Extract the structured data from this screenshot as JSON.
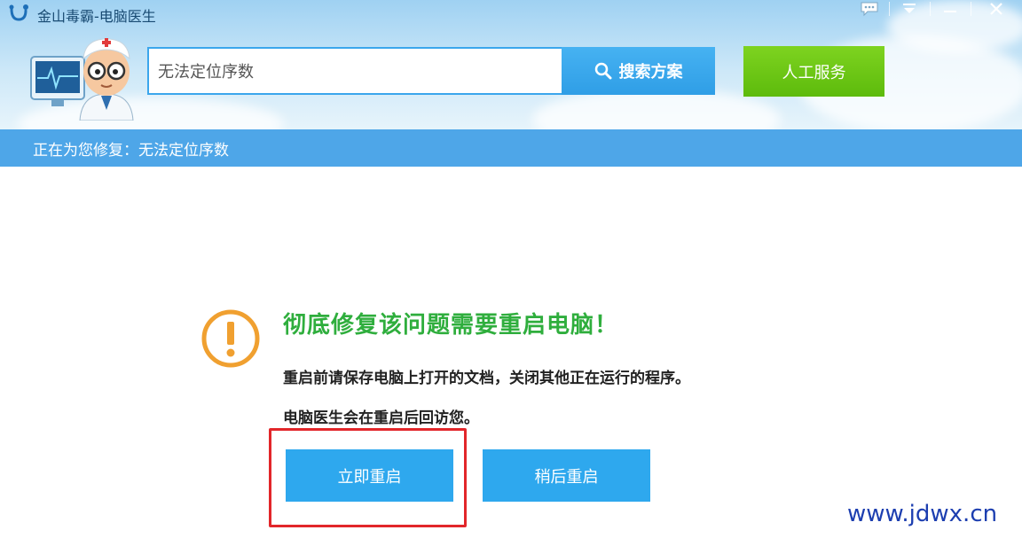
{
  "window": {
    "title": "金山毒霸-电脑医生",
    "controls": [
      "chat-icon",
      "menu-icon",
      "minimize-icon",
      "close-icon"
    ]
  },
  "search": {
    "value": "无法定位序数",
    "button_label": "搜索方案"
  },
  "human_service": {
    "label": "人工服务"
  },
  "status_bar": {
    "text": "正在为您修复：无法定位序数"
  },
  "notice": {
    "headline": "彻底修复该问题需要重启电脑！",
    "line1": "重启前请保存电脑上打开的文档，关闭其他正在运行的程序。",
    "line2": "电脑医生会在重启后回访您。"
  },
  "buttons": {
    "restart_now": "立即重启",
    "restart_later": "稍后重启"
  },
  "watermark": "www.jdwx.cn",
  "colors": {
    "accent_blue": "#2ea8ee",
    "status_blue": "#4ea6e8",
    "green": "#5dbb0c",
    "headline_green": "#2fae3d",
    "warning_orange": "#f0a030",
    "highlight_red": "#e2262a"
  }
}
